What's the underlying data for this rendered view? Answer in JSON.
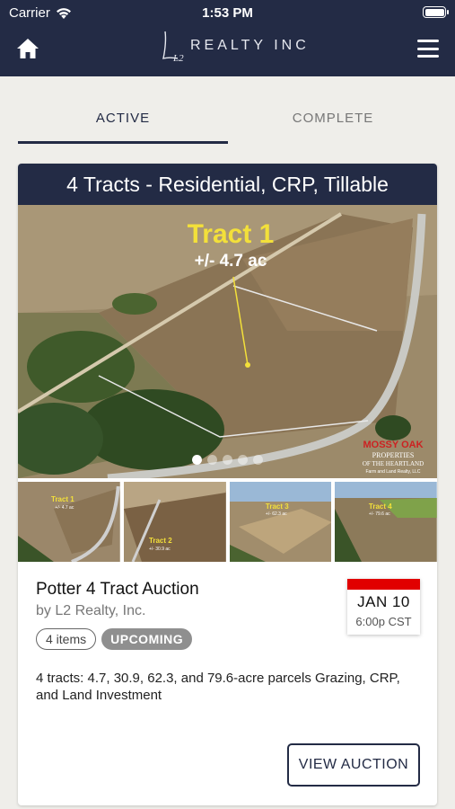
{
  "status_bar": {
    "carrier": "Carrier",
    "time": "1:53 PM"
  },
  "header": {
    "logo_text": "REALTY INC",
    "logo_mark": "L2"
  },
  "tabs": [
    {
      "label": "ACTIVE",
      "active": true
    },
    {
      "label": "COMPLETE",
      "active": false
    }
  ],
  "listing": {
    "banner_title": "4 Tracts - Residential, CRP, Tillable",
    "hero_overlay": {
      "title": "Tract 1",
      "subtitle": "+/- 4.7 ac"
    },
    "watermark": [
      "MOSSY OAK",
      "PROPERTIES",
      "OF THE HEARTLAND",
      "Farm and Land Realty, LLC"
    ],
    "carousel": {
      "total": 5,
      "active": 1
    },
    "auction_title": "Potter 4 Tract Auction",
    "by_line": "by L2 Realty, Inc.",
    "items_chip": "4 items",
    "status_chip": "UPCOMING",
    "date": "JAN 10",
    "time": "6:00p CST",
    "description": "4 tracts: 4.7, 30.9, 62.3, and 79.6-acre parcels Grazing, CRP, and Land Investment",
    "button_label": "VIEW AUCTION"
  },
  "thumbnails": [
    {
      "label": "Tract 1",
      "acreage": "+/- 4.7 ac"
    },
    {
      "label": "Tract 2",
      "acreage": "+/- 30.9 ac"
    },
    {
      "label": "Tract 3",
      "acreage": "+/- 62.3 ac"
    },
    {
      "label": "Tract 4",
      "acreage": "+/- 79.6 ac"
    }
  ],
  "colors": {
    "header_bg": "#232b45",
    "accent_red": "#e10000",
    "tract_label": "#f3e03a",
    "background": "#efeeea"
  },
  "icons": [
    "wifi-icon",
    "battery-icon",
    "home-icon",
    "menu-icon",
    "mossy-oak-logo"
  ]
}
